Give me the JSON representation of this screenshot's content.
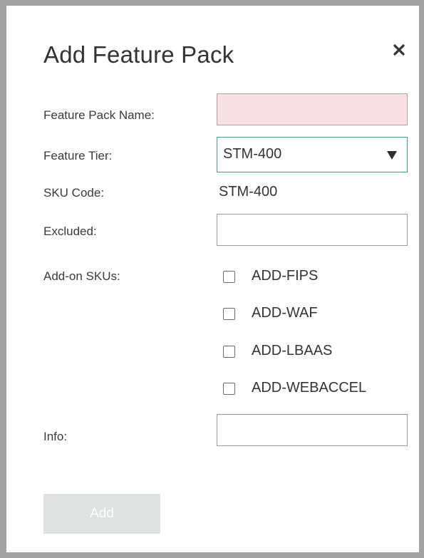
{
  "dialog": {
    "title": "Add Feature Pack",
    "close_icon": "close-icon"
  },
  "form": {
    "feature_pack_name": {
      "label": "Feature Pack Name:",
      "value": "",
      "placeholder": "",
      "state": "invalid",
      "state_color": "#f9e1e3"
    },
    "feature_tier": {
      "label": "Feature Tier:",
      "selected": "STM-400",
      "icon": "dropdown-arrow-icon",
      "focus_color": "#3a9f8c"
    },
    "sku_code": {
      "label": "SKU Code:",
      "value": "STM-400"
    },
    "excluded": {
      "label": "Excluded:",
      "value": "",
      "placeholder": ""
    },
    "addon_skus": {
      "label": "Add-on SKUs:",
      "options": [
        {
          "label": "ADD-FIPS",
          "checked": false
        },
        {
          "label": "ADD-WAF",
          "checked": false
        },
        {
          "label": "ADD-LBAAS",
          "checked": false
        },
        {
          "label": "ADD-WEBACCEL",
          "checked": false
        }
      ]
    },
    "info": {
      "label": "Info:",
      "value": "",
      "placeholder": ""
    }
  },
  "actions": {
    "add_label": "Add",
    "add_disabled": true
  }
}
